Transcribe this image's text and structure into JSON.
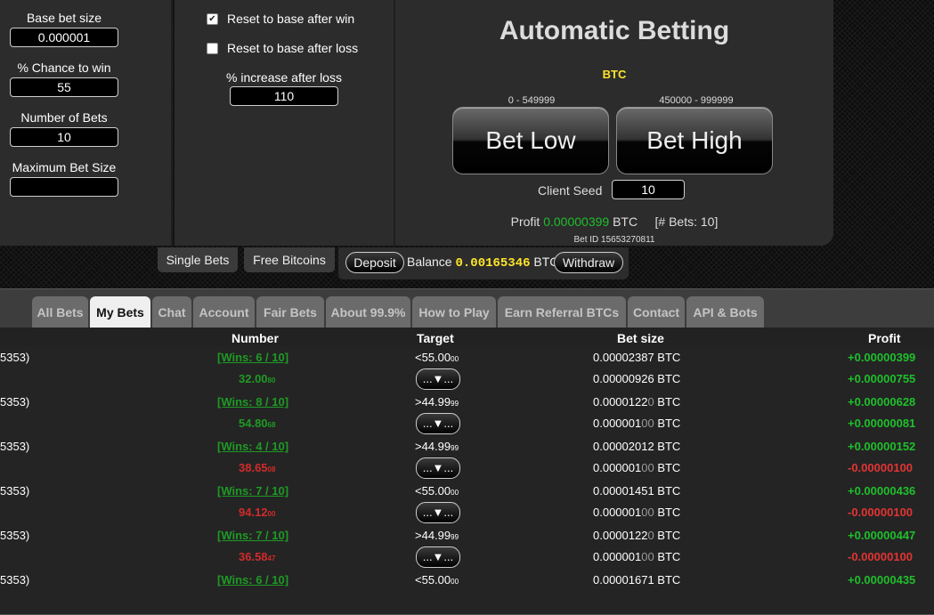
{
  "settings": {
    "base_bet_label": "Base bet size",
    "base_bet_value": "0.000001",
    "chance_label": "% Chance to win",
    "chance_value": "55",
    "num_bets_label": "Number of Bets",
    "num_bets_value": "10",
    "max_bet_label": "Maximum Bet Size",
    "max_bet_value": "",
    "reset_win_label": "Reset to base after win",
    "reset_win_checked": true,
    "reset_loss_label": "Reset to base after loss",
    "reset_loss_checked": false,
    "increase_label": "% increase after loss",
    "increase_value": "110"
  },
  "auto": {
    "title": "Automatic Betting",
    "coin": "BTC",
    "low_range": "0 - 549999",
    "high_range": "450000 - 999999",
    "bet_low_label": "Bet Low",
    "bet_high_label": "Bet High",
    "client_seed_label": "Client Seed",
    "client_seed_value": "10",
    "profit_label": "Profit",
    "profit_value": "0.00000399",
    "profit_unit": "BTC",
    "bets_count": "[# Bets: 10]",
    "bet_id": "Bet ID 15653270811"
  },
  "toolbar": {
    "single_bets": "Single Bets",
    "free_bitcoins": "Free Bitcoins",
    "deposit": "Deposit",
    "balance_label": "Balance",
    "balance_value": "0.00165346",
    "balance_unit": "BTC",
    "withdraw": "Withdraw"
  },
  "tabs": [
    "All Bets",
    "My Bets",
    "Chat",
    "Account",
    "Fair Bets",
    "About 99.9%",
    "How to Play",
    "Earn Referral BTCs",
    "Contact",
    "API & Bots"
  ],
  "active_tab": "My Bets",
  "table": {
    "headers": {
      "number": "Number",
      "target": "Target",
      "bet_size": "Bet size",
      "profit": "Profit"
    },
    "groups": [
      {
        "id_tail": "5353)",
        "wins": "[Wins: 6 / 10]",
        "target": "<55.00",
        "target_small": "00",
        "roll": "32.00",
        "roll_small": "80",
        "roll_color": "up",
        "bet1": "0.00002387 BTC",
        "bet2_main": "0.00000926",
        "bet2_dim": "",
        "bet2_unit": " BTC",
        "profit1": "+0.00000399",
        "profit2_main": "+0.00000755",
        "profit2_dim": "",
        "profit2_sign": "pos"
      },
      {
        "id_tail": "5353)",
        "wins": "[Wins: 8 / 10]",
        "target": ">44.99",
        "target_small": "99",
        "roll": "54.80",
        "roll_small": "68",
        "roll_color": "up",
        "bet1_main": "0.0000122",
        "bet1_dim": "0",
        "bet1": "0.00001220 BTC",
        "bet2_main": "0.000001",
        "bet2_dim": "00",
        "bet2_unit": " BTC",
        "profit1": "+0.00000628",
        "profit2_main": "+0.00000081",
        "profit2_dim": "",
        "profit2_sign": "pos"
      },
      {
        "id_tail": "5353)",
        "wins": "[Wins: 4 / 10]",
        "target": ">44.99",
        "target_small": "99",
        "roll": "38.65",
        "roll_small": "08",
        "roll_color": "down",
        "bet1": "0.00002012 BTC",
        "bet2_main": "0.000001",
        "bet2_dim": "00",
        "bet2_unit": " BTC",
        "profit1": "+0.00000152",
        "profit2_main": "-0.000001",
        "profit2_dim": "00",
        "profit2_sign": "neg"
      },
      {
        "id_tail": "5353)",
        "wins": "[Wins: 7 / 10]",
        "target": "<55.00",
        "target_small": "00",
        "roll": "94.12",
        "roll_small": "00",
        "roll_color": "down",
        "bet1": "0.00001451 BTC",
        "bet2_main": "0.000001",
        "bet2_dim": "00",
        "bet2_unit": " BTC",
        "profit1": "+0.00000436",
        "profit2_main": "-0.000001",
        "profit2_dim": "00",
        "profit2_sign": "neg"
      },
      {
        "id_tail": "5353)",
        "wins": "[Wins: 7 / 10]",
        "target": ">44.99",
        "target_small": "99",
        "roll": "36.58",
        "roll_small": "47",
        "roll_color": "down",
        "bet1_main": "0.0000122",
        "bet1_dim": "0",
        "bet1": "0.00001220 BTC",
        "bet2_main": "0.000001",
        "bet2_dim": "00",
        "bet2_unit": " BTC",
        "profit1": "+0.00000447",
        "profit2_main": "-0.000001",
        "profit2_dim": "00",
        "profit2_sign": "neg"
      },
      {
        "id_tail": "5353)",
        "wins": "[Wins: 6 / 10]",
        "target": "<55.00",
        "target_small": "00",
        "bet1": "0.00001671 BTC",
        "profit1": "+0.00000435"
      }
    ],
    "detail_button": "...▼..."
  }
}
